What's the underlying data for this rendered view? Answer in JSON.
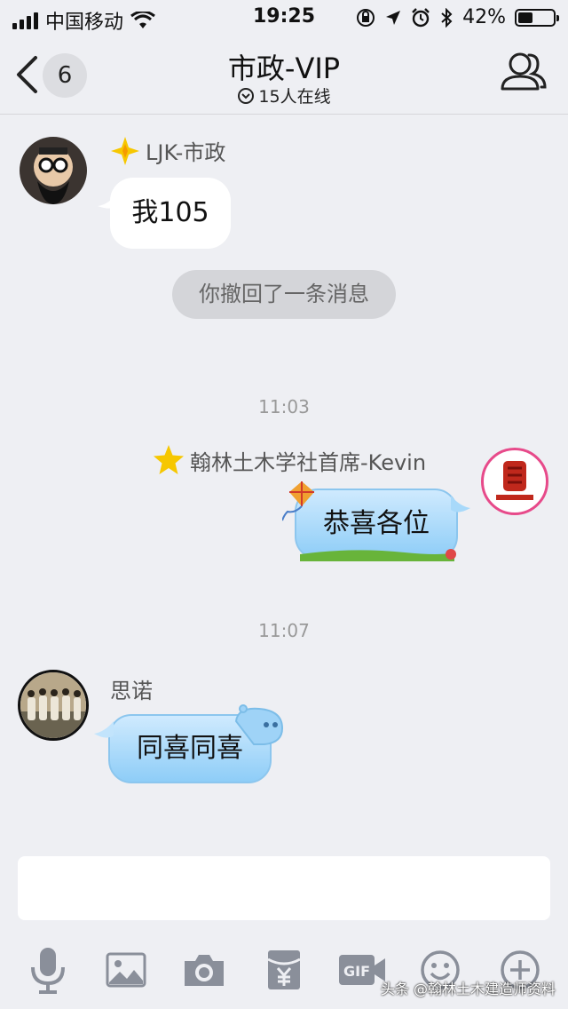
{
  "status_bar": {
    "carrier": "中国移动",
    "time": "19:25",
    "battery": "42%",
    "battery_level": 0.42
  },
  "nav": {
    "unread_count": "6",
    "title": "市政-VIP",
    "online": "15人在线"
  },
  "messages": [
    {
      "sender": "LJK-市政",
      "text": "我105"
    },
    {
      "system": "你撤回了一条消息"
    },
    {
      "timestamp": "11:03"
    },
    {
      "sender": "翰林土木学社首席-Kevin",
      "text": "恭喜各位"
    },
    {
      "timestamp": "11:07"
    },
    {
      "sender": "思诺",
      "text": "同喜同喜"
    }
  ],
  "watermark": "头条 @翰林土木建造师资料",
  "colors": {
    "background": "#eeeff3",
    "bubble_blue": "#8ecdf7",
    "star": "#f6c700"
  }
}
